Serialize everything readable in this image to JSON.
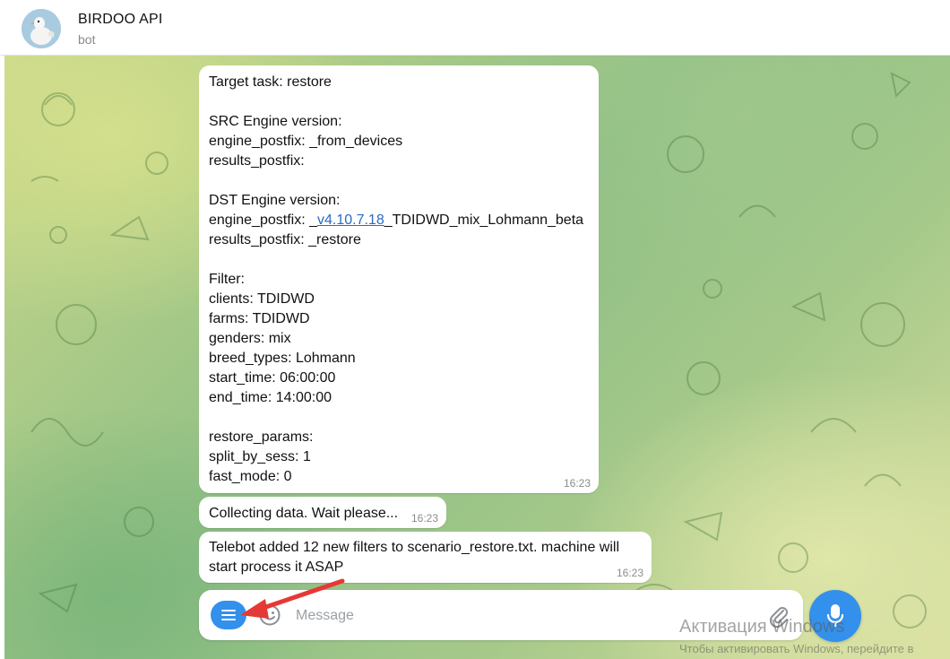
{
  "header": {
    "title": "BIRDOO API",
    "subtitle": "bot"
  },
  "messages": [
    {
      "lines": [
        "Target task: restore",
        "",
        "SRC Engine version:",
        "engine_postfix: _from_devices",
        "results_postfix:",
        "",
        "DST Engine version:",
        "",
        "results_postfix: _restore",
        "",
        "Filter:",
        "clients: TDIDWD",
        "farms: TDIDWD",
        "genders: mix",
        "breed_types: Lohmann",
        "start_time: 06:00:00",
        "end_time: 14:00:00",
        "",
        "restore_params:",
        "split_by_sess: 1",
        "fast_mode: 0"
      ],
      "dst_line": {
        "prefix": "engine_postfix: _",
        "link": "v4.10.7.18",
        "suffix": "_TDIDWD_mix_Lohmann_beta"
      },
      "time": "16:23"
    },
    {
      "text": "Collecting data. Wait please...",
      "time": "16:23"
    },
    {
      "lines": [
        "Telebot added 12 new filters to scenario_restore.txt. machine will",
        "start process it ASAP"
      ],
      "time": "16:23"
    }
  ],
  "composer": {
    "placeholder": "Message"
  },
  "watermark": {
    "title": "Активация Windows",
    "subtitle": "Чтобы активировать Windows, перейдите в"
  },
  "colors": {
    "accent": "#3390ec",
    "link": "#2a6bc4",
    "annotation": "#e53935"
  }
}
